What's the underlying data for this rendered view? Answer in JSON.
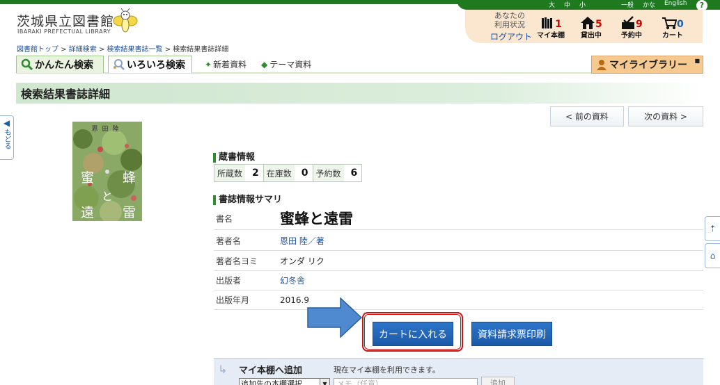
{
  "header": {
    "logo_jp": "茨城県立図書館",
    "logo_en": "IBARAKI PREFECTUAL LIBRARY",
    "font_sizes": [
      "大",
      "中",
      "小"
    ],
    "lang_options": [
      "一般",
      "かな",
      "English"
    ],
    "help_label": "?"
  },
  "status": {
    "label_line1": "あなたの",
    "label_line2": "利用状況",
    "logout": "ログアウト",
    "items": [
      {
        "label": "マイ本棚",
        "count": "1"
      },
      {
        "label": "貸出中",
        "count": "5"
      },
      {
        "label": "予約中",
        "count": "9"
      },
      {
        "label": "カート",
        "count": "0"
      }
    ]
  },
  "breadcrumb": {
    "items": [
      "図書館トップ",
      "詳細検索",
      "検索結果書誌一覧",
      "検索結果書誌詳細"
    ],
    "sep": ">"
  },
  "tabs": {
    "simple": "かんたん検索",
    "advanced": "いろいろ検索",
    "new": "新着資料",
    "theme": "テーマ資料",
    "mylibrary": "マイライブラリー"
  },
  "page_title": "検索結果書誌詳細",
  "back_label": "もどる",
  "nav": {
    "prev": "< 前の資料",
    "next": "次の資料 >"
  },
  "cover": {
    "author": "恩田陸",
    "chars": [
      "蜜",
      "と",
      "蜂",
      "遠",
      "雷"
    ]
  },
  "holdings": {
    "heading": "蔵書情報",
    "cells": [
      {
        "label": "所蔵数",
        "value": "2"
      },
      {
        "label": "在庫数",
        "value": "0"
      },
      {
        "label": "予約数",
        "value": "6"
      }
    ]
  },
  "summary": {
    "heading": "書誌情報サマリ",
    "rows": [
      {
        "label": "書名",
        "value": "蜜蜂と遠雷"
      },
      {
        "label": "著者名",
        "value": "恩田 陸／著"
      },
      {
        "label": "著者名ヨミ",
        "value": "オンダ リク"
      },
      {
        "label": "出版者",
        "value": "幻冬舎"
      },
      {
        "label": "出版年月",
        "value": "2016.9"
      }
    ]
  },
  "actions": {
    "cart": "カートに入れる",
    "print": "資料請求票印刷"
  },
  "myshelf": {
    "title": "マイ本棚へ追加",
    "note": "現在マイ本棚を利用できます。",
    "select_value": "追加先の本棚選択",
    "memo_placeholder": "メモ（任意）",
    "add": "追加"
  },
  "colors": {
    "brand_green": "#1f7a1f",
    "button_blue": "#1b59a8",
    "highlight_red": "#c81414",
    "count_red": "#d40000"
  }
}
